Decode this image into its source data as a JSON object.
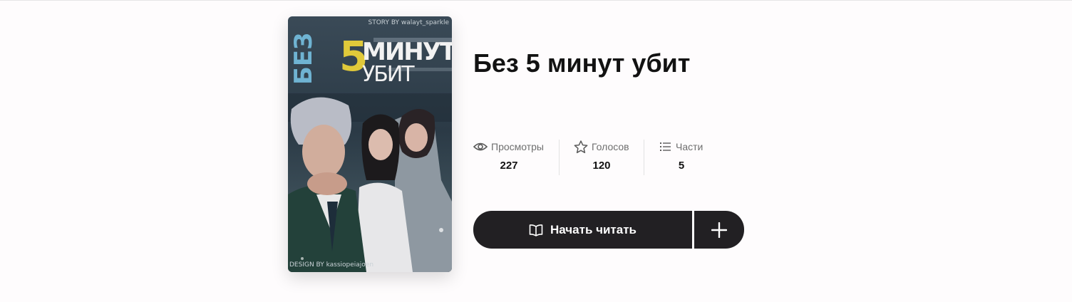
{
  "book": {
    "title": "Без 5 минут убит"
  },
  "cover": {
    "title_line1": "МИНУТ",
    "title_number": "5",
    "title_line2": "УБИТ",
    "title_vertical": "БЕЗ",
    "credit_top": "STORY BY walayt_sparkle",
    "credit_bottom": "DESIGN BY kassiopeiajoen",
    "accent_color": "#e0c93a"
  },
  "stats": {
    "views": {
      "label": "Просмотры",
      "value": "227",
      "icon": "eye-icon"
    },
    "votes": {
      "label": "Голосов",
      "value": "120",
      "icon": "star-icon"
    },
    "parts": {
      "label": "Части",
      "value": "5",
      "icon": "list-icon"
    }
  },
  "actions": {
    "start_reading_label": "Начать читать",
    "start_reading_icon": "open-book-icon",
    "add_icon": "plus-icon",
    "button_color": "#222023"
  }
}
